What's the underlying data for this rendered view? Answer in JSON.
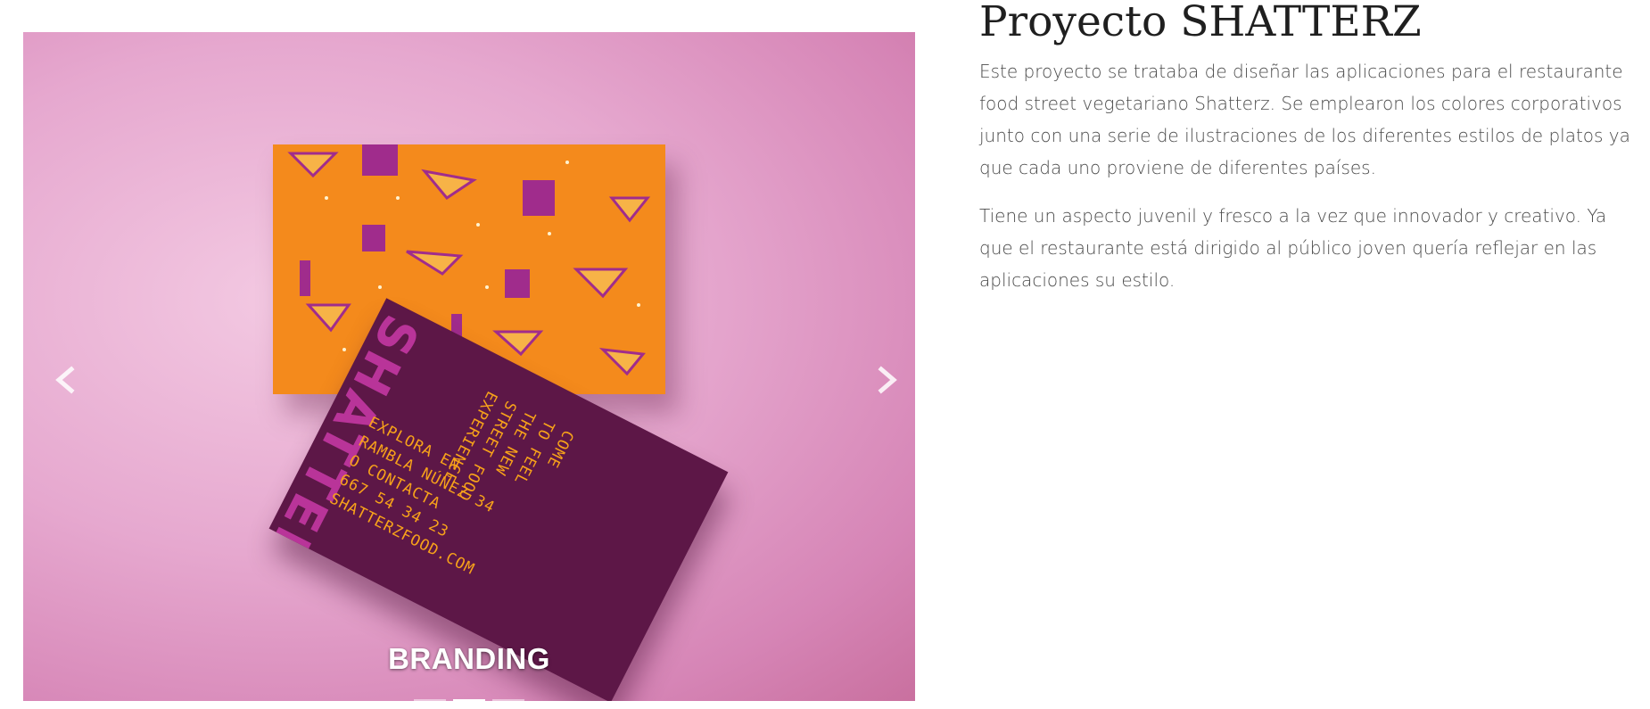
{
  "carousel": {
    "caption": "BRANDING",
    "prev_label": "Previous",
    "next_label": "Next",
    "slide_count": 3,
    "active_slide_index": 1,
    "background_color": "#e6a8cf",
    "card_top_color": "#f48a1c",
    "card_bottom_color": "#5d1747",
    "card_accent_color": "#c93aa9",
    "card_text_color": "#f7a21a",
    "card_logo": "SHATTERZ",
    "card_address_lines": "EXPLORA EN\nRAMBLA NÚÑEZ 34\nO CONTACTA\n667 54 34 23\nSHATTERZFOOD.COM",
    "card_tagline": "COME\nTO FEEL\nTHE NEW\nSTREET FOOD\nEXPERIENCE"
  },
  "project": {
    "title": "Proyecto SHATTERZ",
    "paragraphs": [
      "Este proyecto se trataba de diseñar las aplicaciones para el restaurante food street vegetariano Shatterz. Se emplearon los colores corporativos junto con una serie de ilustraciones de los diferentes estilos de platos ya que cada uno proviene de diferentes países.",
      "Tiene un aspecto juvenil y fresco a la vez que innovador y creativo. Ya que el restaurante está dirigido al público joven quería reflejar en las aplicaciones su estilo."
    ]
  }
}
